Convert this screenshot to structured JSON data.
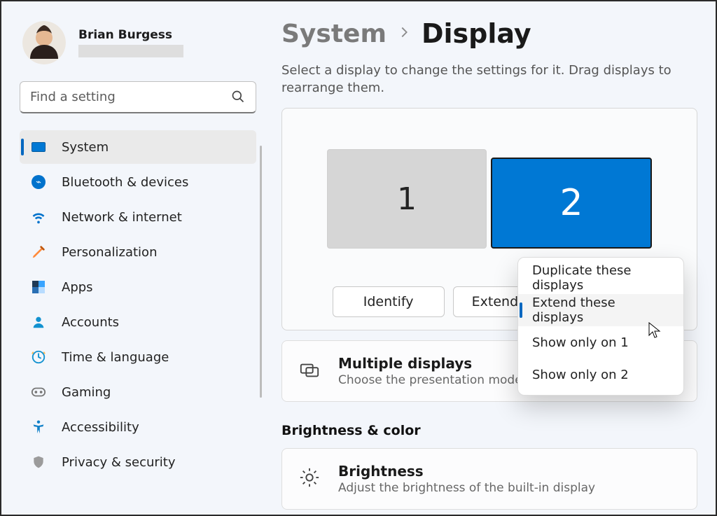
{
  "user": {
    "name": "Brian Burgess"
  },
  "search": {
    "placeholder": "Find a setting"
  },
  "sidebar": {
    "items": [
      {
        "label": "System",
        "icon": "system-icon",
        "selected": true
      },
      {
        "label": "Bluetooth & devices",
        "icon": "bluetooth-icon",
        "selected": false
      },
      {
        "label": "Network & internet",
        "icon": "wifi-icon",
        "selected": false
      },
      {
        "label": "Personalization",
        "icon": "personalization-icon",
        "selected": false
      },
      {
        "label": "Apps",
        "icon": "apps-icon",
        "selected": false
      },
      {
        "label": "Accounts",
        "icon": "accounts-icon",
        "selected": false
      },
      {
        "label": "Time & language",
        "icon": "clock-icon",
        "selected": false
      },
      {
        "label": "Gaming",
        "icon": "gamepad-icon",
        "selected": false
      },
      {
        "label": "Accessibility",
        "icon": "accessibility-icon",
        "selected": false
      },
      {
        "label": "Privacy & security",
        "icon": "shield-icon",
        "selected": false
      }
    ]
  },
  "breadcrumb": {
    "parent": "System",
    "page": "Display"
  },
  "instructions": "Select a display to change the settings for it. Drag displays to rearrange them.",
  "displays": {
    "primary_label": "1",
    "secondary_label": "2",
    "selected": 2
  },
  "identify_label": "Identify",
  "mode_menu": {
    "options": [
      "Duplicate these displays",
      "Extend these displays",
      "Show only on 1",
      "Show only on 2"
    ],
    "selected_index": 1
  },
  "multiple_displays": {
    "title": "Multiple displays",
    "subtitle": "Choose the presentation mode for"
  },
  "section_bc": "Brightness & color",
  "brightness": {
    "title": "Brightness",
    "subtitle": "Adjust the brightness of the built-in display"
  }
}
